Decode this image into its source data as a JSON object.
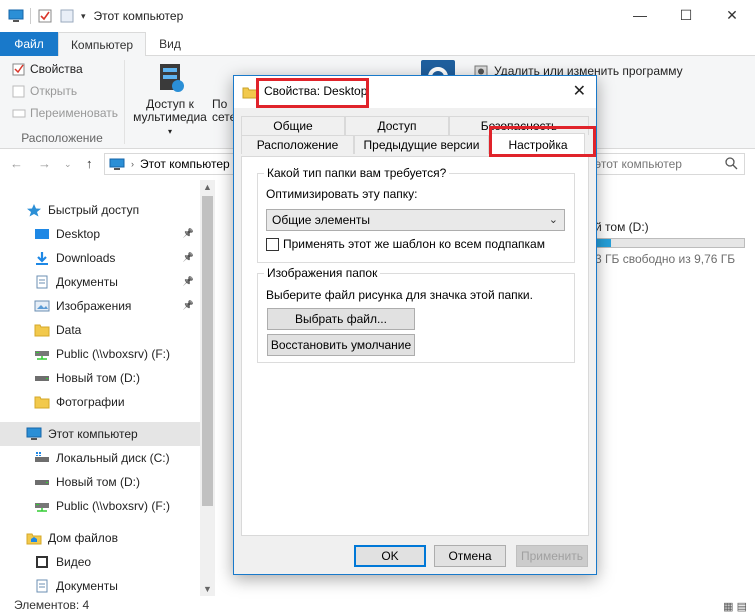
{
  "window": {
    "title": "Этот компьютер",
    "controls": [
      "—",
      "☐",
      "✕"
    ]
  },
  "ribbon": {
    "tabs": [
      "Файл",
      "Компьютер",
      "Вид"
    ],
    "groups": {
      "location": {
        "properties": "Свойства",
        "open": "Открыть",
        "rename": "Переименовать",
        "label": "Расположение"
      },
      "media": {
        "line1": "Доступ к",
        "line2": "мультимедиа"
      },
      "network": {
        "line1": "По",
        "line2": "сете"
      }
    },
    "uninstall": "Удалить или изменить программу",
    "help_chev": "⌄",
    "help_q": "?"
  },
  "address": {
    "path": "Этот компьютер",
    "search_placeholder": "этот компьютер"
  },
  "sidebar": {
    "items": [
      {
        "label": "Быстрый доступ",
        "icon": "star-icon",
        "indent": 1
      },
      {
        "label": "Desktop",
        "icon": "desktop-folder-icon",
        "indent": 2,
        "pinned": true
      },
      {
        "label": "Downloads",
        "icon": "download-icon",
        "indent": 2,
        "pinned": true
      },
      {
        "label": "Документы",
        "icon": "document-icon",
        "indent": 2,
        "pinned": true
      },
      {
        "label": "Изображения",
        "icon": "pictures-icon",
        "indent": 2,
        "pinned": true
      },
      {
        "label": "Data",
        "icon": "folder-icon",
        "indent": 2
      },
      {
        "label": "Public (\\\\vboxsrv) (F:)",
        "icon": "network-drive-icon",
        "indent": 2
      },
      {
        "label": "Новый том (D:)",
        "icon": "drive-icon",
        "indent": 2
      },
      {
        "label": "Фотографии",
        "icon": "folder-icon",
        "indent": 2
      },
      {
        "label": "Этот компьютер",
        "icon": "computer-icon",
        "indent": 1,
        "selected": true
      },
      {
        "label": "Локальный диск (C:)",
        "icon": "system-drive-icon",
        "indent": 2
      },
      {
        "label": "Новый том (D:)",
        "icon": "drive-icon",
        "indent": 2
      },
      {
        "label": "Public (\\\\vboxsrv) (F:)",
        "icon": "network-drive-icon",
        "indent": 2
      },
      {
        "label": "Дом файлов",
        "icon": "home-folder-icon",
        "indent": 1
      },
      {
        "label": "Видео",
        "icon": "video-icon",
        "indent": 2
      },
      {
        "label": "Документы",
        "icon": "document-icon",
        "indent": 2
      }
    ]
  },
  "content": {
    "drive_name": "й том (D:)",
    "drive_free": "3 ГБ свободно из 9,76 ГБ",
    "drive_used_fraction": 0.1
  },
  "status": {
    "text": "Элементов: 4"
  },
  "dialog": {
    "title": "Свойства: Desktop",
    "tabs_row1": [
      "Общие",
      "Доступ",
      "Безопасность"
    ],
    "tabs_row2": [
      "Расположение",
      "Предыдущие версии",
      "Настройка"
    ],
    "folder_type_group": "Какой тип папки вам требуется?",
    "optimize_label": "Оптимизировать эту папку:",
    "optimize_value": "Общие элементы",
    "apply_subfolders": "Применять этот же шаблон ко всем подпапкам",
    "images_group": "Изображения папок",
    "images_desc": "Выберите файл рисунка для значка этой папки.",
    "choose_file": "Выбрать файл...",
    "restore_default": "Восстановить умолчание",
    "ok": "OK",
    "cancel": "Отмена",
    "apply": "Применить",
    "highlight_color": "#e0232a"
  }
}
